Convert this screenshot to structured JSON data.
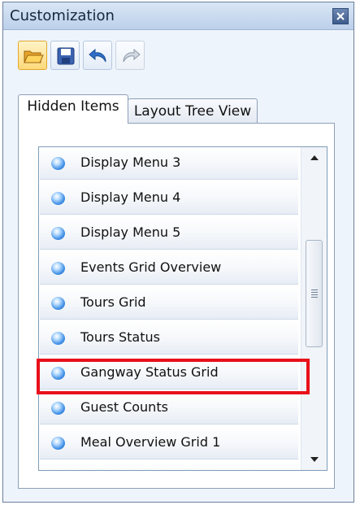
{
  "window": {
    "title": "Customization"
  },
  "toolbar": {
    "buttons": [
      {
        "icon": "open-folder-icon"
      },
      {
        "icon": "save-icon"
      },
      {
        "icon": "undo-icon"
      },
      {
        "icon": "redo-icon"
      }
    ]
  },
  "tabs": [
    {
      "label": "Hidden Items",
      "active": true
    },
    {
      "label": "Layout Tree View",
      "active": false
    }
  ],
  "list": {
    "items": [
      {
        "label": "Display Menu 3"
      },
      {
        "label": "Display Menu 4"
      },
      {
        "label": "Display Menu 5"
      },
      {
        "label": "Events Grid Overview"
      },
      {
        "label": "Tours Grid"
      },
      {
        "label": "Tours Status"
      },
      {
        "label": "Gangway Status Grid",
        "highlighted": true
      },
      {
        "label": "Guest Counts"
      },
      {
        "label": "Meal Overview Grid 1"
      }
    ]
  },
  "colors": {
    "highlight": "#e8101a",
    "item_dot": "#3f8fe6"
  }
}
